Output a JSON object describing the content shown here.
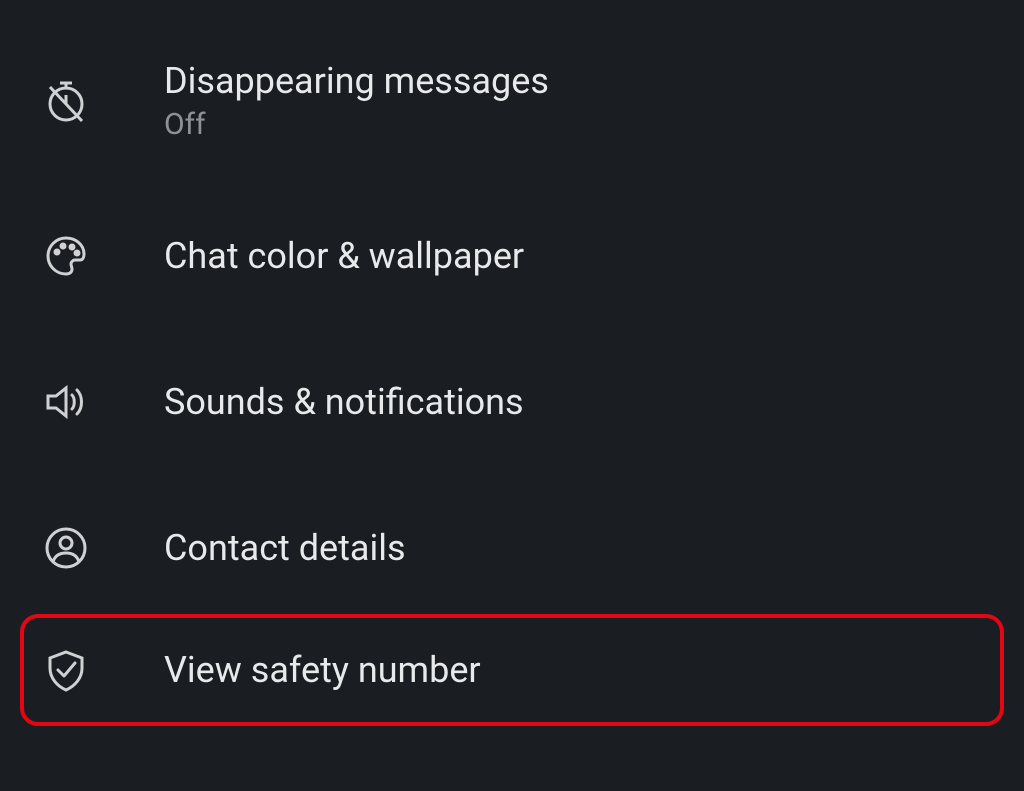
{
  "settings": {
    "items": [
      {
        "label": "Disappearing messages",
        "sublabel": "Off"
      },
      {
        "label": "Chat color & wallpaper"
      },
      {
        "label": "Sounds & notifications"
      },
      {
        "label": "Contact details"
      },
      {
        "label": "View safety number"
      }
    ]
  },
  "colors": {
    "background": "#1a1d21",
    "text_primary": "#e8e9eb",
    "text_secondary": "#8e9197",
    "icon": "#d0d1d3",
    "highlight": "#e30613"
  }
}
